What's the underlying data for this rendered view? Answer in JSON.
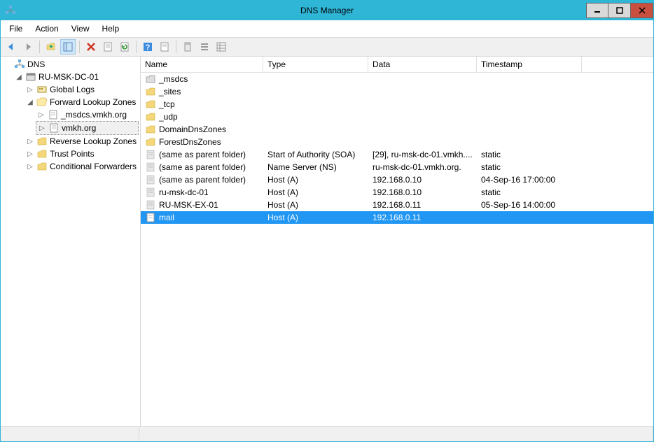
{
  "window": {
    "title": "DNS Manager"
  },
  "menubar": {
    "file": "File",
    "action": "Action",
    "view": "View",
    "help": "Help"
  },
  "tree": {
    "root": "DNS",
    "server": "RU-MSK-DC-01",
    "global_logs": "Global Logs",
    "flz": "Forward Lookup Zones",
    "zone_msdcs": "_msdcs.vmkh.org",
    "zone_main": "vmkh.org",
    "rlz": "Reverse Lookup Zones",
    "trust_points": "Trust Points",
    "cond_fwd": "Conditional Forwarders"
  },
  "columns": {
    "name": "Name",
    "type": "Type",
    "data": "Data",
    "timestamp": "Timestamp"
  },
  "records": {
    "r0": {
      "name": "_msdcs"
    },
    "r1": {
      "name": "_sites"
    },
    "r2": {
      "name": "_tcp"
    },
    "r3": {
      "name": "_udp"
    },
    "r4": {
      "name": "DomainDnsZones"
    },
    "r5": {
      "name": "ForestDnsZones"
    },
    "r6": {
      "name": "(same as parent folder)",
      "type": "Start of Authority (SOA)",
      "data": "[29], ru-msk-dc-01.vmkh....",
      "ts": "static"
    },
    "r7": {
      "name": "(same as parent folder)",
      "type": "Name Server (NS)",
      "data": "ru-msk-dc-01.vmkh.org.",
      "ts": "static"
    },
    "r8": {
      "name": "(same as parent folder)",
      "type": "Host (A)",
      "data": "192.168.0.10",
      "ts": "04-Sep-16 17:00:00"
    },
    "r9": {
      "name": "ru-msk-dc-01",
      "type": "Host (A)",
      "data": "192.168.0.10",
      "ts": "static"
    },
    "r10": {
      "name": "RU-MSK-EX-01",
      "type": "Host (A)",
      "data": "192.168.0.11",
      "ts": "05-Sep-16 14:00:00"
    },
    "r11": {
      "name": "mail",
      "type": "Host (A)",
      "data": "192.168.0.11",
      "ts": ""
    }
  }
}
